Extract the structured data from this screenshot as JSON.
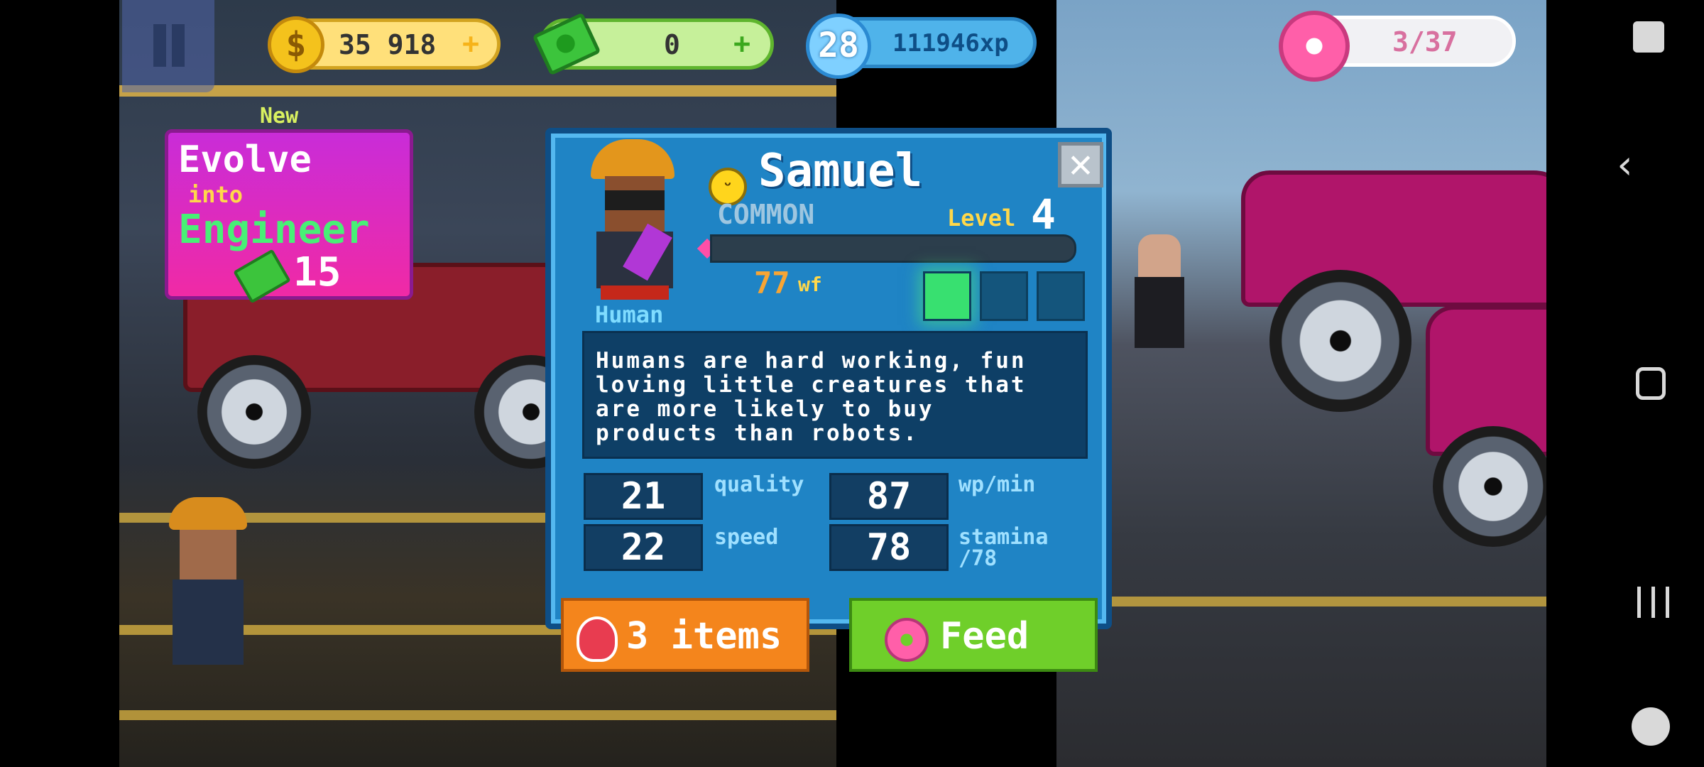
{
  "hud": {
    "coins": "35 918",
    "cash": "0",
    "level_badge": "28",
    "xp": "111946xp",
    "donuts": "3/37",
    "plus": "+"
  },
  "evolve": {
    "new_label": "New",
    "line1": "Evolve",
    "line2": "into",
    "line3": "Engineer",
    "cost": "15"
  },
  "character": {
    "name": "Samuel",
    "race": "Human",
    "rarity": "COMMON",
    "level_label": "Level",
    "level": "4",
    "wf_value": "77",
    "wf_unit": "wf",
    "xp_progress": 0,
    "slots_filled": 1,
    "slots_total": 3,
    "description": "Humans are hard working, fun\nloving little creatures that\nare more likely to buy\nproducts than robots.",
    "close_glyph": "✕"
  },
  "stats": {
    "quality_value": "21",
    "quality_label": "quality",
    "wpmin_value": "87",
    "wpmin_label": "wp/min",
    "speed_value": "22",
    "speed_label": "speed",
    "stamina_value": "78",
    "stamina_label": "stamina\n/78"
  },
  "buttons": {
    "items": "3 items",
    "feed": "Feed"
  },
  "icons": {
    "coin": "coin-icon",
    "cash": "cash-icon",
    "xp": "xp-star-icon",
    "donut": "donut-icon",
    "mood": "happy-face-icon",
    "potion": "potion-icon"
  },
  "colors": {
    "dialog_bg": "#1f84c5",
    "evolve_bg": "#f02aa5",
    "feed_btn": "#6fcf2a",
    "items_btn": "#f4851c"
  }
}
